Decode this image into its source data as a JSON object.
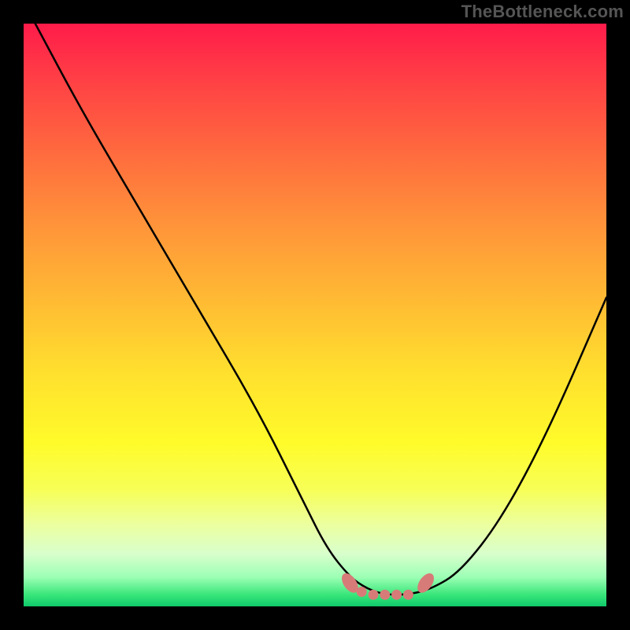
{
  "watermark": "TheBottleneck.com",
  "colors": {
    "gradient_top": "#ff1b4a",
    "gradient_mid": "#ffe02e",
    "gradient_bottom": "#0fc96a",
    "curve": "#000000",
    "marker": "#d77b78",
    "frame": "#000000",
    "watermark_text": "#555555"
  },
  "chart_data": {
    "type": "line",
    "title": "",
    "xlabel": "",
    "ylabel": "",
    "xlim": [
      0,
      100
    ],
    "ylim": [
      0,
      100
    ],
    "grid": false,
    "legend": false,
    "series": [
      {
        "name": "bottleneck-curve",
        "x": [
          2,
          10,
          20,
          30,
          40,
          48,
          52,
          56,
          59,
          62,
          66,
          70,
          75,
          82,
          90,
          100
        ],
        "y": [
          100,
          85,
          68,
          51,
          34,
          18,
          10,
          5,
          3,
          2,
          2,
          3,
          6,
          15,
          30,
          53
        ]
      }
    ],
    "markers": [
      {
        "name": "valley-left-edge",
        "x": 56,
        "y": 4
      },
      {
        "name": "valley-dot-a",
        "x": 58,
        "y": 2.5
      },
      {
        "name": "valley-dot-b",
        "x": 60,
        "y": 2
      },
      {
        "name": "valley-dot-c",
        "x": 62,
        "y": 2
      },
      {
        "name": "valley-dot-d",
        "x": 64,
        "y": 2
      },
      {
        "name": "valley-dot-e",
        "x": 66,
        "y": 2
      },
      {
        "name": "valley-right-edge",
        "x": 69,
        "y": 4
      }
    ],
    "annotations": []
  }
}
